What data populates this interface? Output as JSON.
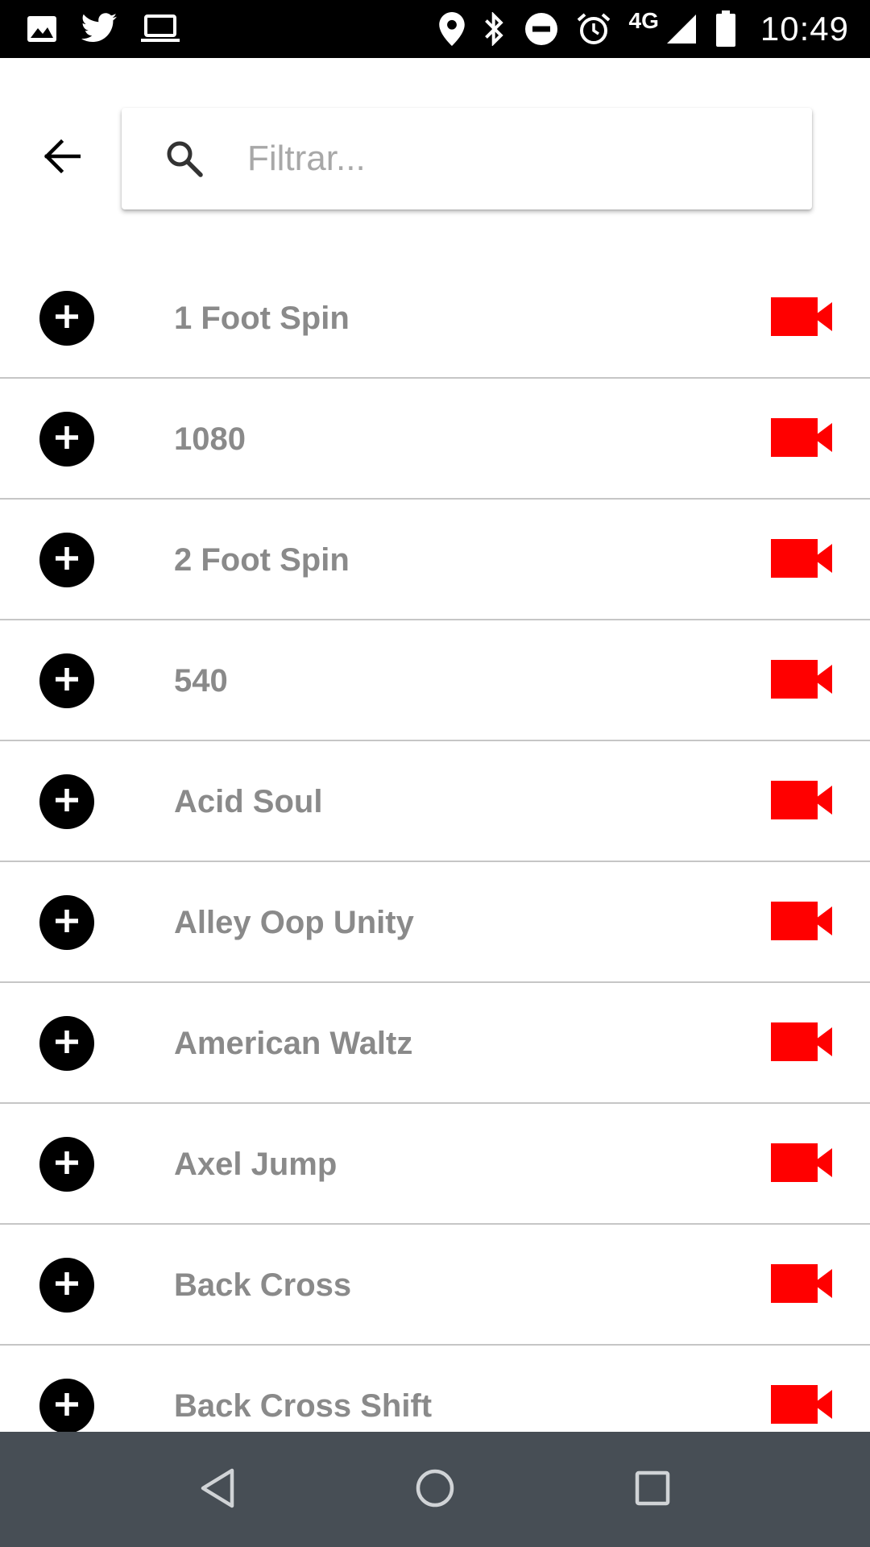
{
  "status_bar": {
    "icons_left": [
      "image-icon",
      "twitter-icon",
      "laptop-icon"
    ],
    "icons_right": [
      "location-icon",
      "bluetooth-icon",
      "do-not-disturb-icon",
      "alarm-icon",
      "signal-icon",
      "battery-icon"
    ],
    "network_label": "4G",
    "time": "10:49"
  },
  "header": {
    "back_icon": "arrow-left-icon",
    "search_icon": "search-icon",
    "search_placeholder": "Filtrar..."
  },
  "list": {
    "add_icon": "plus-circle-icon",
    "video_icon": "videocam-icon",
    "video_color": "#ff0000",
    "items": [
      {
        "name": "1 Foot Spin"
      },
      {
        "name": "1080"
      },
      {
        "name": "2 Foot Spin"
      },
      {
        "name": "540"
      },
      {
        "name": "Acid Soul"
      },
      {
        "name": "Alley Oop Unity"
      },
      {
        "name": "American Waltz"
      },
      {
        "name": "Axel Jump"
      },
      {
        "name": "Back Cross"
      },
      {
        "name": "Back Cross Shift"
      }
    ]
  },
  "nav_bar": {
    "background": "#474e55",
    "buttons": [
      "nav-back-icon",
      "nav-home-icon",
      "nav-recents-icon"
    ]
  }
}
